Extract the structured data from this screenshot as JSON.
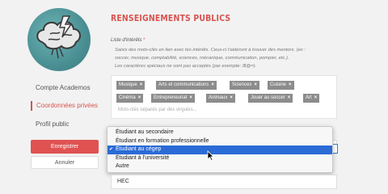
{
  "sidebar": {
    "items": [
      {
        "label": "Compte Academos"
      },
      {
        "label": "Coordonnées privées"
      },
      {
        "label": "Profil public"
      }
    ],
    "primary_button": "Enregistrer",
    "secondary_button": "Annuler"
  },
  "main": {
    "section_title": "RENSEIGNEMENTS PUBLICS",
    "interests": {
      "label": "Liste d'intérêts",
      "required_mark": "*",
      "help_lines": [
        "Saisis des mots-clés en lien avec tes intérêts. Ceux-ci t'aideront à trouver des mentors. (ex :",
        "soccer, musique, comptabilité, sciences, mécanique, communication, pompier, etc.).",
        "Les caractères spéciaux ne sont pas acceptés (par exemple: /$@=)."
      ],
      "tags": [
        "Musique",
        "Arts et communications",
        "Sciences",
        "Cuisine",
        "Cinéma",
        "Entrepreneuriat",
        "Animaux",
        "Jouer au soccer",
        "Art"
      ],
      "placeholder": "Mots-clés séparés par des virgules..."
    },
    "status_select": {
      "options": [
        "Étudiant au secondaire",
        "Étudiant en formation professionnelle",
        "Étudiant au cégep",
        "Étudiant à l'université",
        "Autre"
      ],
      "selected": "Étudiant au cégep"
    },
    "school_input": {
      "value": "HEC"
    }
  },
  "colors": {
    "accent": "#d9534f",
    "tag_bg": "#8c8c8c",
    "selection": "#2a6bd6"
  }
}
